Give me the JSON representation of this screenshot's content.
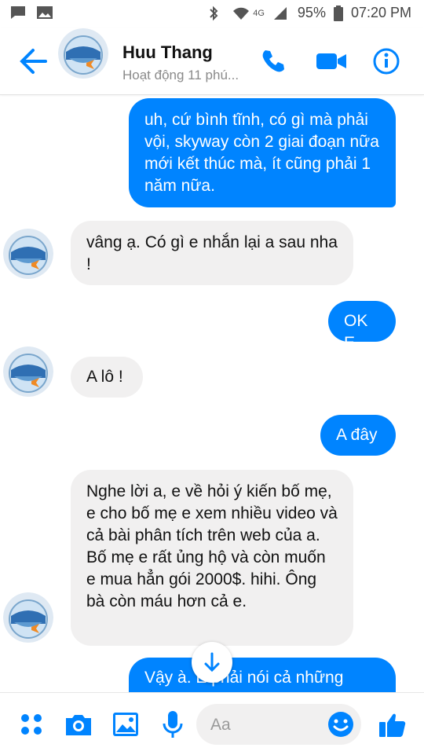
{
  "status_bar": {
    "network": "4G",
    "battery": "95%",
    "time": "07:20 PM"
  },
  "header": {
    "contact_name": "Huu Thang",
    "contact_status": "Hoạt động 11 phú...",
    "icons": [
      "back-arrow-icon",
      "phone-icon",
      "video-camera-icon",
      "info-icon"
    ]
  },
  "messages": [
    {
      "from": "me",
      "text": "uh, cứ bình tĩnh, có gì mà phải vội, skyway  còn 2 giai đoạn nữa mới kết thúc mà, ít cũng phải 1 năm nữa."
    },
    {
      "from": "contact",
      "text": "vâng ạ. Có gì e nhắn lại a sau nha !"
    },
    {
      "from": "me",
      "text": "OK E"
    },
    {
      "from": "contact",
      "text": "A lô !"
    },
    {
      "from": "me",
      "text": "A đây"
    },
    {
      "from": "contact",
      "text": "Nghe lời a, e về hỏi ý kiến bố mẹ, e cho bố mẹ e xem nhiều video và cả bài phân tích trên web của a. Bố mẹ e rất ủng hộ và còn muốn e mua hẳn gói 2000$. hihi. Ông bà còn máu hơn cả e."
    },
    {
      "from": "me",
      "text": "Vậy à. E phải nói cả những"
    }
  ],
  "composer": {
    "placeholder": "Aa",
    "icons": [
      "more-apps-icon",
      "camera-icon",
      "gallery-icon",
      "microphone-icon",
      "emoji-icon",
      "like-icon"
    ]
  },
  "colors": {
    "accent": "#0084ff",
    "incoming_bubble": "#f1f0f0",
    "outgoing_text": "#ffffff"
  }
}
